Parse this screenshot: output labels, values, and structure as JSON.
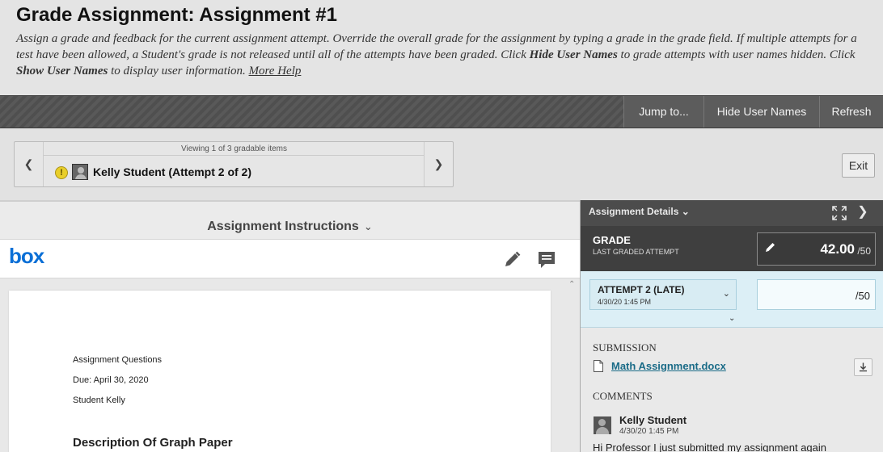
{
  "header": {
    "title": "Grade Assignment: Assignment #1",
    "desc_part1": "Assign a grade and feedback for the current assignment attempt. Override the overall grade for the assignment by typing a grade in the grade field. If multiple attempts for a test have been allowed, a Student's grade is not released until all of the attempts have been graded. Click ",
    "desc_hide_names": "Hide User Names",
    "desc_part2": " to grade attempts with user names hidden. Click ",
    "desc_show_names": "Show User Names",
    "desc_part3": " to display user information. ",
    "more_help": "More Help"
  },
  "toolbar": {
    "jump_to": "Jump to...",
    "hide_user_names": "Hide User Names",
    "refresh": "Refresh"
  },
  "navigator": {
    "count_text": "Viewing 1 of 3 gradable items",
    "student_label": "Kelly Student (Attempt 2 of 2)",
    "prev_icon": "chevron-left-icon",
    "next_icon": "chevron-right-icon",
    "status_icon": "needs-grading-icon"
  },
  "exit_label": "Exit",
  "instructions": {
    "label": "Assignment Instructions"
  },
  "viewer": {
    "logo": "box",
    "tools": [
      "pencil-icon",
      "comment-icon"
    ]
  },
  "document": {
    "line1": "Assignment Questions",
    "line2": "Due:  April 30, 2020",
    "line3": "Student Kelly",
    "heading": "Description Of Graph Paper"
  },
  "details": {
    "title": "Assignment Details",
    "grade_label": "GRADE",
    "grade_sub": "LAST GRADED ATTEMPT",
    "grade_value": "42.00",
    "grade_total": "/50",
    "attempt_name": "ATTEMPT 2 (LATE)",
    "attempt_date": "4/30/20 1:45 PM",
    "attempt_total": "/50",
    "submission_label": "SUBMISSION",
    "file_name": "Math Assignment.docx",
    "comments_label": "COMMENTS",
    "comment_author": "Kelly Student",
    "comment_date": "4/30/20 1:45 PM",
    "comment_text": "Hi Professor I just submitted my assignment again"
  },
  "colors": {
    "box_blue": "#0a6fd6",
    "link_teal": "#1a6b87",
    "attempt_bg": "#dceff6",
    "grade_bg": "#3f3f3f"
  }
}
